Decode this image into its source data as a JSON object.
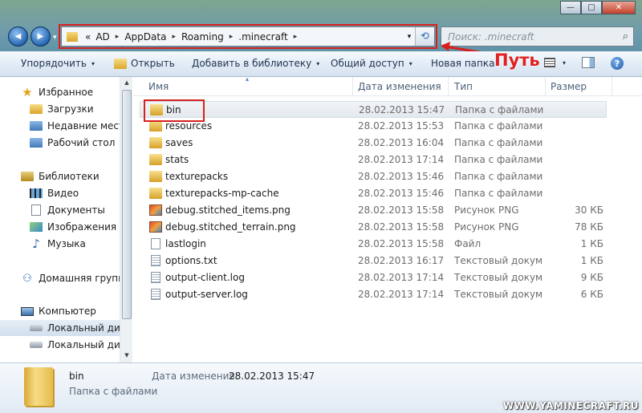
{
  "window": {
    "minimize_label": "—",
    "maximize_label": "□",
    "close_label": "✕"
  },
  "nav": {
    "back_icon": "arrow-left-icon",
    "forward_icon": "arrow-right-icon",
    "back_glyph": "◀",
    "forward_glyph": "▶",
    "history_glyph": "▾"
  },
  "address": {
    "overflow": "«",
    "crumbs": [
      "AD",
      "AppData",
      "Roaming",
      ".minecraft"
    ],
    "separator": "▸",
    "dropdown": "▾",
    "refresh_glyph": "⟲"
  },
  "search": {
    "placeholder": "Поиск: .minecraft",
    "icon_glyph": "⌕"
  },
  "toolbar": {
    "organize": "Упорядочить",
    "open": "Открыть",
    "add_to_library": "Добавить в библиотеку",
    "share": "Общий доступ",
    "new_folder": "Новая папка",
    "caret": "▾",
    "help_glyph": "?"
  },
  "annotation": {
    "label": "Путь",
    "color": "#d6201e"
  },
  "sidebar": {
    "items": [
      {
        "label": "Избранное",
        "icon": "star-icon"
      },
      {
        "label": "Загрузки",
        "icon": "downloads-icon"
      },
      {
        "label": "Недавние места",
        "icon": "recent-places-icon"
      },
      {
        "label": "Рабочий стол",
        "icon": "desktop-icon"
      },
      {
        "label": "Библиотеки",
        "icon": "libraries-icon"
      },
      {
        "label": "Видео",
        "icon": "video-icon"
      },
      {
        "label": "Документы",
        "icon": "documents-icon"
      },
      {
        "label": "Изображения",
        "icon": "pictures-icon"
      },
      {
        "label": "Музыка",
        "icon": "music-icon"
      },
      {
        "label": "Домашняя группа",
        "icon": "homegroup-icon"
      },
      {
        "label": "Компьютер",
        "icon": "computer-icon"
      },
      {
        "label": "Локальный диск",
        "icon": "disk-icon"
      },
      {
        "label": "Локальный диск",
        "icon": "disk-icon"
      }
    ],
    "star_glyph": "★",
    "music_glyph": "♪",
    "net_glyph": "⚇"
  },
  "columns": {
    "name": "Имя",
    "modified": "Дата изменения",
    "type": "Тип",
    "size": "Размер",
    "sort_glyph": "▴"
  },
  "files": [
    {
      "name": "bin",
      "modified": "28.02.2013 15:47",
      "type": "Папка с файлами",
      "size": "",
      "kind": "folder"
    },
    {
      "name": "resources",
      "modified": "28.02.2013 15:53",
      "type": "Папка с файлами",
      "size": "",
      "kind": "folder"
    },
    {
      "name": "saves",
      "modified": "28.02.2013 16:04",
      "type": "Папка с файлами",
      "size": "",
      "kind": "folder"
    },
    {
      "name": "stats",
      "modified": "28.02.2013 17:14",
      "type": "Папка с файлами",
      "size": "",
      "kind": "folder"
    },
    {
      "name": "texturepacks",
      "modified": "28.02.2013 15:46",
      "type": "Папка с файлами",
      "size": "",
      "kind": "folder"
    },
    {
      "name": "texturepacks-mp-cache",
      "modified": "28.02.2013 15:46",
      "type": "Папка с файлами",
      "size": "",
      "kind": "folder"
    },
    {
      "name": "debug.stitched_items.png",
      "modified": "28.02.2013 15:58",
      "type": "Рисунок PNG",
      "size": "30 КБ",
      "kind": "png"
    },
    {
      "name": "debug.stitched_terrain.png",
      "modified": "28.02.2013 15:58",
      "type": "Рисунок PNG",
      "size": "78 КБ",
      "kind": "png"
    },
    {
      "name": "lastlogin",
      "modified": "28.02.2013 15:58",
      "type": "Файл",
      "size": "1 КБ",
      "kind": "file"
    },
    {
      "name": "options.txt",
      "modified": "28.02.2013 16:17",
      "type": "Текстовый докум...",
      "size": "1 КБ",
      "kind": "txt"
    },
    {
      "name": "output-client.log",
      "modified": "28.02.2013 17:14",
      "type": "Текстовый докум...",
      "size": "9 КБ",
      "kind": "txt"
    },
    {
      "name": "output-server.log",
      "modified": "28.02.2013 17:14",
      "type": "Текстовый докум...",
      "size": "6 КБ",
      "kind": "txt"
    }
  ],
  "details": {
    "name": "bin",
    "type": "Папка с файлами",
    "modified_label": "Дата изменения:",
    "modified_value": "28.02.2013 15:47",
    "icon": "folder-large-icon"
  },
  "watermark": "WWW.YAMINECRAFT.RU"
}
